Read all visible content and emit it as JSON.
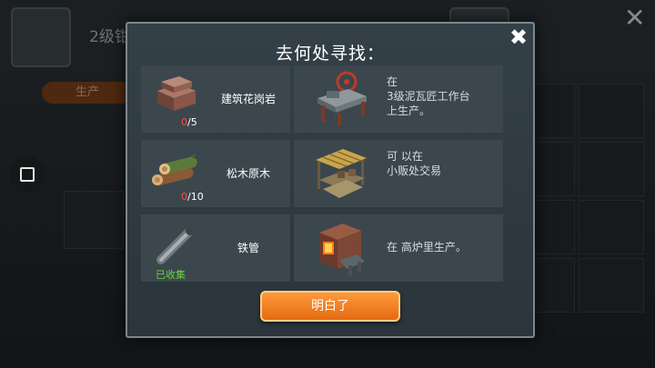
{
  "background": {
    "title": "2级钳",
    "tab_label": "生产",
    "side_button_icon": "square-icon",
    "close_icon": "close-icon"
  },
  "dialog": {
    "title": "去何处寻找：",
    "close_icon": "close-icon",
    "rows": [
      {
        "item_name": "建筑花岗岩",
        "item_icon": "granite-block-icon",
        "have": "0",
        "need": "/5",
        "source_icon": "mason-workbench-icon",
        "source_text": "在\n3级泥瓦匠工作台\n上生产。"
      },
      {
        "item_name": "松木原木",
        "item_icon": "pine-log-icon",
        "have": "0",
        "need": "/10",
        "source_icon": "trader-stall-icon",
        "source_text": "可 以在\n小贩处交易"
      },
      {
        "item_name": "铁管",
        "item_icon": "iron-pipe-icon",
        "status": "已收集",
        "source_icon": "blast-furnace-icon",
        "source_text": "在 高炉里生产。"
      }
    ],
    "confirm_label": "明白了"
  },
  "colors": {
    "panel": "#3b474d",
    "accent_button": "#f0821f",
    "missing_count": "#ff4a4a",
    "collected": "#6dd046"
  }
}
